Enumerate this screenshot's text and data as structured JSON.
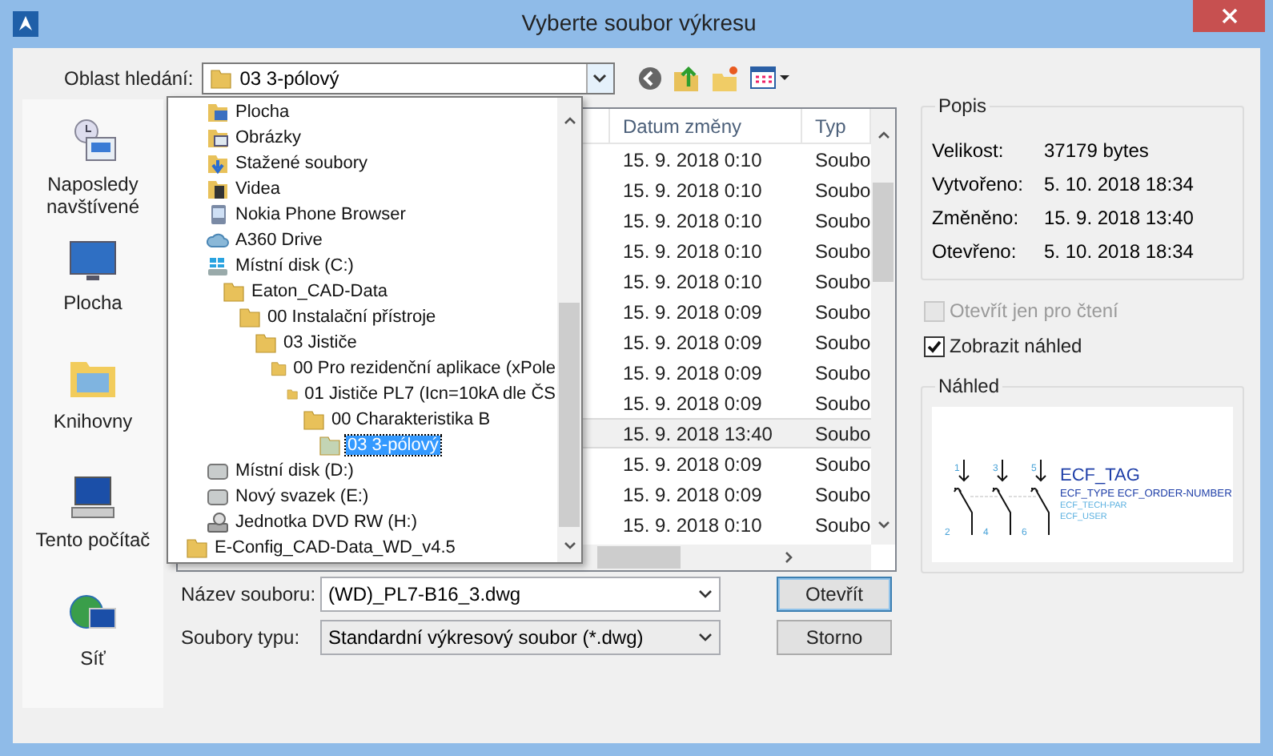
{
  "window": {
    "title": "Vyberte soubor výkresu"
  },
  "look_in": {
    "label": "Oblast hledání:",
    "value": "03 3-pólový"
  },
  "dropdown": {
    "items": [
      {
        "label": "Plocha",
        "kind": "desktop",
        "selected": false
      },
      {
        "label": "Obrázky",
        "kind": "pictures",
        "selected": false
      },
      {
        "label": "Stažené soubory",
        "kind": "downloads",
        "selected": false
      },
      {
        "label": "Videa",
        "kind": "videos",
        "selected": false
      },
      {
        "label": "Nokia Phone Browser",
        "kind": "phone",
        "selected": false
      },
      {
        "label": "A360 Drive",
        "kind": "cloud",
        "selected": false
      },
      {
        "label": "Místní disk (C:)",
        "kind": "system",
        "selected": false,
        "children": [
          {
            "label": "Eaton_CAD-Data",
            "kind": "folder",
            "selected": false,
            "children": [
              {
                "label": "00 Instalační přístroje",
                "kind": "folder",
                "selected": false,
                "children": [
                  {
                    "label": "03 Jističe",
                    "kind": "folder",
                    "selected": false,
                    "children": [
                      {
                        "label": "00 Pro rezidenční aplikace (xPole",
                        "kind": "folder",
                        "selected": false,
                        "children": [
                          {
                            "label": "01 Jističe PL7 (Icn=10kA dle ČS",
                            "kind": "folder",
                            "selected": false,
                            "children": [
                              {
                                "label": "00 Charakteristika B",
                                "kind": "folder",
                                "selected": false,
                                "children": [
                                  {
                                    "label": "03 3-pólový",
                                    "kind": "folder",
                                    "selected": true
                                  }
                                ]
                              }
                            ]
                          }
                        ]
                      }
                    ]
                  }
                ]
              }
            ]
          }
        ]
      },
      {
        "label": "Místní disk (D:)",
        "kind": "drive",
        "selected": false
      },
      {
        "label": "Nový svazek (E:)",
        "kind": "drive",
        "selected": false
      },
      {
        "label": "Jednotka DVD RW (H:)",
        "kind": "dvd",
        "selected": false
      }
    ],
    "trailing_items": [
      {
        "label": "E-Config_CAD-Data_WD_v4.5",
        "kind": "folder",
        "selected": false
      }
    ]
  },
  "places": [
    {
      "label": "Naposledy navštívené",
      "kind": "recent"
    },
    {
      "label": "Plocha",
      "kind": "desktop"
    },
    {
      "label": "Knihovny",
      "kind": "libraries"
    },
    {
      "label": "Tento počítač",
      "kind": "computer"
    },
    {
      "label": "Síť",
      "kind": "network"
    }
  ],
  "table": {
    "columns": [
      "Datum změny",
      "Typ"
    ],
    "rows": [
      {
        "date": "15. 9. 2018 0:10",
        "type": "Soubo",
        "selected": false
      },
      {
        "date": "15. 9. 2018 0:10",
        "type": "Soubo",
        "selected": false
      },
      {
        "date": "15. 9. 2018 0:10",
        "type": "Soubo",
        "selected": false
      },
      {
        "date": "15. 9. 2018 0:10",
        "type": "Soubo",
        "selected": false
      },
      {
        "date": "15. 9. 2018 0:10",
        "type": "Soubo",
        "selected": false
      },
      {
        "date": "15. 9. 2018 0:09",
        "type": "Soubo",
        "selected": false
      },
      {
        "date": "15. 9. 2018 0:09",
        "type": "Soubo",
        "selected": false
      },
      {
        "date": "15. 9. 2018 0:09",
        "type": "Soubo",
        "selected": false
      },
      {
        "date": "15. 9. 2018 0:09",
        "type": "Soubo",
        "selected": false
      },
      {
        "date": "15. 9. 2018 13:40",
        "type": "Soubo",
        "selected": true
      },
      {
        "date": "15. 9. 2018 0:09",
        "type": "Soubo",
        "selected": false
      },
      {
        "date": "15. 9. 2018 0:09",
        "type": "Soubo",
        "selected": false
      },
      {
        "date": "15. 9. 2018 0:10",
        "type": "Soubo",
        "selected": false
      }
    ]
  },
  "file_name": {
    "label": "Název souboru:",
    "value": "(WD)_PL7-B16_3.dwg"
  },
  "file_type": {
    "label": "Soubory typu:",
    "value": "Standardní výkresový soubor (*.dwg)"
  },
  "buttons": [
    {
      "label": "Otevřít",
      "default": true
    },
    {
      "label": "Storno",
      "default": false
    }
  ],
  "description": {
    "title": "Popis",
    "fields": [
      {
        "label": "Velikost:",
        "value": "37179 bytes"
      },
      {
        "label": "Vytvořeno:",
        "value": "5. 10. 2018 18:34"
      },
      {
        "label": "Změněno:",
        "value": "15. 9. 2018 13:40"
      },
      {
        "label": "Otevřeno:",
        "value": "5. 10. 2018 18:34"
      }
    ]
  },
  "options": [
    {
      "label": "Otevřít jen pro čtení",
      "checked": false,
      "disabled": true
    },
    {
      "label": "Zobrazit náhled",
      "checked": true,
      "disabled": false
    }
  ],
  "preview": {
    "title": "Náhled",
    "tag": "ECF_TAG",
    "lines": [
      "ECF_TYPE  ECF_ORDER-NUMBER",
      "ECF_TECH-PAR",
      "ECF_USER"
    ],
    "top_pins": [
      "1",
      "3",
      "5"
    ],
    "bottom_pins": [
      "2",
      "4",
      "6"
    ]
  }
}
